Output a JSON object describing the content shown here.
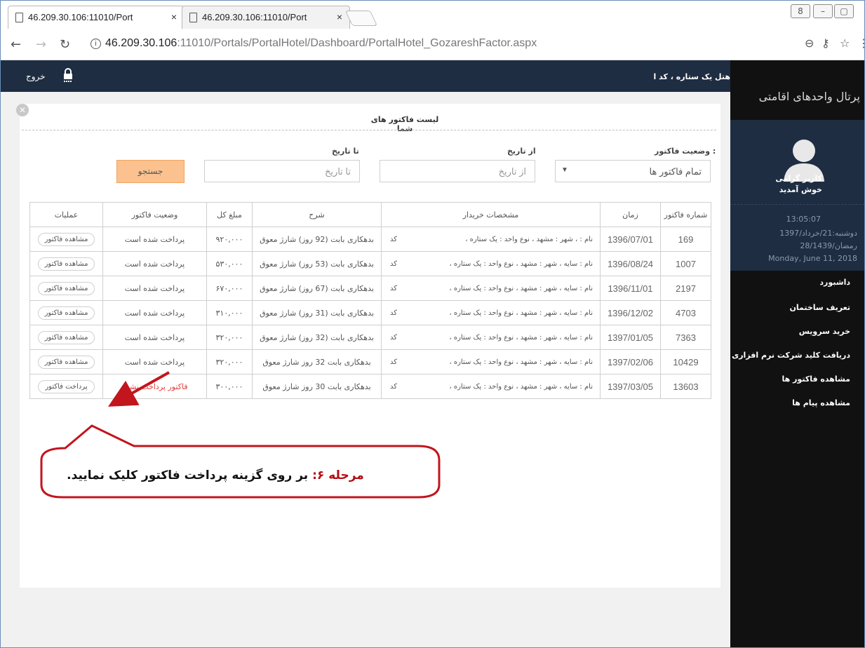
{
  "browser": {
    "tabs": [
      {
        "title": "46.209.30.106:11010/Port",
        "close": "×"
      },
      {
        "title": "46.209.30.106:11010/Port",
        "close": "×"
      }
    ],
    "url_host": "46.209.30.106",
    "url_rest": ":11010/Portals/PortalHotel/Dashboard/PortalHotel_GozareshFactor.aspx",
    "window_controls": [
      "8",
      "–",
      "▢",
      "✕"
    ]
  },
  "header": {
    "logout_label": "خروج",
    "hotel_name": "هتل یک ستاره ، کد ا"
  },
  "sidebar": {
    "portal_title": "پرتال واحدهای اقامتی",
    "welcome_line1": "کاربر گرامی",
    "welcome_line2": "خوش آمدید",
    "time": "13:05:07",
    "date_persian": "دوشنبه:21/خرداد/1397",
    "date_hijri": "28/رمضان/1439",
    "date_gregorian": "Monday, June 11, 2018",
    "menu": [
      "داشبورد",
      "تعریف ساختمان",
      "خرید سرویس",
      "دریافت کلید شرکت نرم افزاری",
      "مشاهده فاکتور ها",
      "مشاهده پیام ها"
    ]
  },
  "panel": {
    "title": "لیست فاکتور های شما",
    "filters": {
      "status_label": "وضعیت فاکتور :",
      "status_value": "تمام فاکتور ها",
      "from_label": "از تاریخ",
      "from_placeholder": "از تاریخ",
      "to_label": "تا تاریخ",
      "to_placeholder": "تا تاریخ",
      "search_button": "جستجو"
    },
    "table": {
      "headers": [
        "شماره فاکتور",
        "زمان",
        "مشخصات خریدار",
        "شرح",
        "مبلغ کل",
        "وضعیت فاکتور",
        "عملیات"
      ],
      "rows": [
        {
          "number": "169",
          "date": "1396/07/01",
          "code": "کد",
          "buyer": "، نام :      ، شهر : مشهد ، نوع واحد : یک ستاره",
          "desc": "بدهکاری بابت (92 روز) شارژ معوق",
          "amount": "۹۲۰,۰۰۰",
          "status": "پرداخت شده است",
          "action": "مشاهده فاکتور"
        },
        {
          "number": "1007",
          "date": "1396/08/24",
          "code": "کد",
          "buyer": "، نام : سایه ، شهر : مشهد ، نوع واحد : یک ستاره",
          "desc": "بدهکاری بابت (53 روز) شارژ معوق",
          "amount": "۵۳۰,۰۰۰",
          "status": "پرداخت شده است",
          "action": "مشاهده فاکتور"
        },
        {
          "number": "2197",
          "date": "1396/11/01",
          "code": "کد",
          "buyer": "، نام : سایه ، شهر : مشهد ، نوع واحد : یک ستاره",
          "desc": "بدهکاری بابت (67 روز) شارژ معوق",
          "amount": "۶۷۰,۰۰۰",
          "status": "پرداخت شده است",
          "action": "مشاهده فاکتور"
        },
        {
          "number": "4703",
          "date": "1396/12/02",
          "code": "کد",
          "buyer": "، نام : سایه ، شهر : مشهد ، نوع واحد : یک ستاره",
          "desc": "بدهکاری بابت (31 روز) شارژ معوق",
          "amount": "۳۱۰,۰۰۰",
          "status": "پرداخت شده است",
          "action": "مشاهده فاکتور"
        },
        {
          "number": "7363",
          "date": "1397/01/05",
          "code": "کد",
          "buyer": "، نام : سایه ، شهر : مشهد ، نوع واحد : یک ستاره",
          "desc": "بدهکاری بابت (32 روز) شارژ معوق",
          "amount": "۳۲۰,۰۰۰",
          "status": "پرداخت شده است",
          "action": "مشاهده فاکتور"
        },
        {
          "number": "10429",
          "date": "1397/02/06",
          "code": "کد",
          "buyer": "، نام : سایه ، شهر : مشهد ، نوع واحد : یک ستاره",
          "desc": "بدهکاری بابت 32 روز شارژ معوق",
          "amount": "۳۲۰,۰۰۰",
          "status": "پرداخت شده است",
          "action": "مشاهده فاکتور"
        },
        {
          "number": "13603",
          "date": "1397/03/05",
          "code": "کد",
          "buyer": "، نام : سایه ، شهر : مشهد ، نوع واحد : یک ستاره",
          "desc": "بدهکاری بابت 30 روز شارژ معوق",
          "amount": "۳۰۰,۰۰۰",
          "status": "فاکتور پرداخت نشده",
          "action": "پرداخت فاکتور",
          "unpaid": true
        }
      ]
    }
  },
  "callout": {
    "step": "مرحله ۶:",
    "text": "بر روی گزینه پرداخت فاکتور کلیک نمایید."
  },
  "colors": {
    "header_bg": "#1e2d42",
    "sidebar_bg": "#111111",
    "search_btn": "#fbc28f",
    "unpaid_text": "#e34040",
    "annotation_red": "#b40a12"
  }
}
